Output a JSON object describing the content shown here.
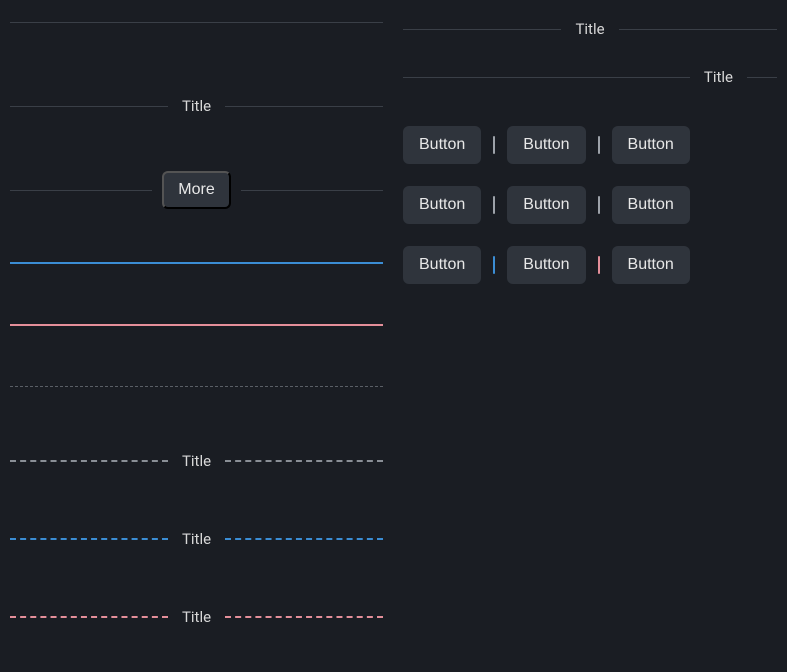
{
  "left": {
    "titleLabel": "Title",
    "moreLabel": "More",
    "dashedTitles": [
      "Title",
      "Title",
      "Title"
    ]
  },
  "right": {
    "titleMid": "Title",
    "titleRight": "Title",
    "rows": [
      {
        "buttons": [
          "Button",
          "Button",
          "Button"
        ],
        "sep": "gray"
      },
      {
        "buttons": [
          "Button",
          "Button",
          "Button"
        ],
        "sep": "gray"
      },
      {
        "buttons": [
          "Button",
          "Button",
          "Button"
        ],
        "sep": "blue-pink"
      }
    ]
  },
  "colors": {
    "blue": "#3b8dd4",
    "pink": "#e48f9a",
    "gray": "#6a6f76"
  }
}
